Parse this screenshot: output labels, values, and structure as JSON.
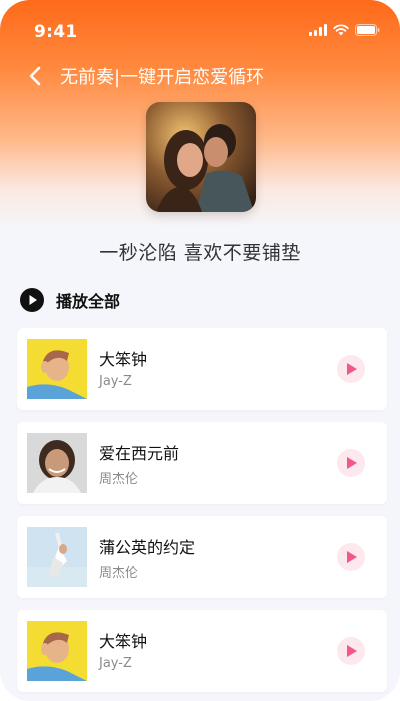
{
  "status_bar": {
    "time": "9:41"
  },
  "nav": {
    "title": "无前奏|一键开启恋爱循环"
  },
  "playlist": {
    "subtitle": "一秒沦陷 喜欢不要铺垫",
    "play_all_label": "播放全部"
  },
  "songs": [
    {
      "title": "大笨钟",
      "artist": "Jay-Z"
    },
    {
      "title": "爱在西元前",
      "artist": "周杰伦"
    },
    {
      "title": "蒲公英的约定",
      "artist": "周杰伦"
    },
    {
      "title": "大笨钟",
      "artist": "Jay-Z"
    }
  ],
  "icons": {
    "signal": "signal-icon",
    "wifi": "wifi-icon",
    "battery": "battery-icon",
    "back": "chevron-left-icon",
    "play_all": "play-circle-icon",
    "play": "play-icon"
  },
  "colors": {
    "accent": "#ff6a1a",
    "play_pink": "#f0588a",
    "play_bg": "#fde8ee"
  }
}
